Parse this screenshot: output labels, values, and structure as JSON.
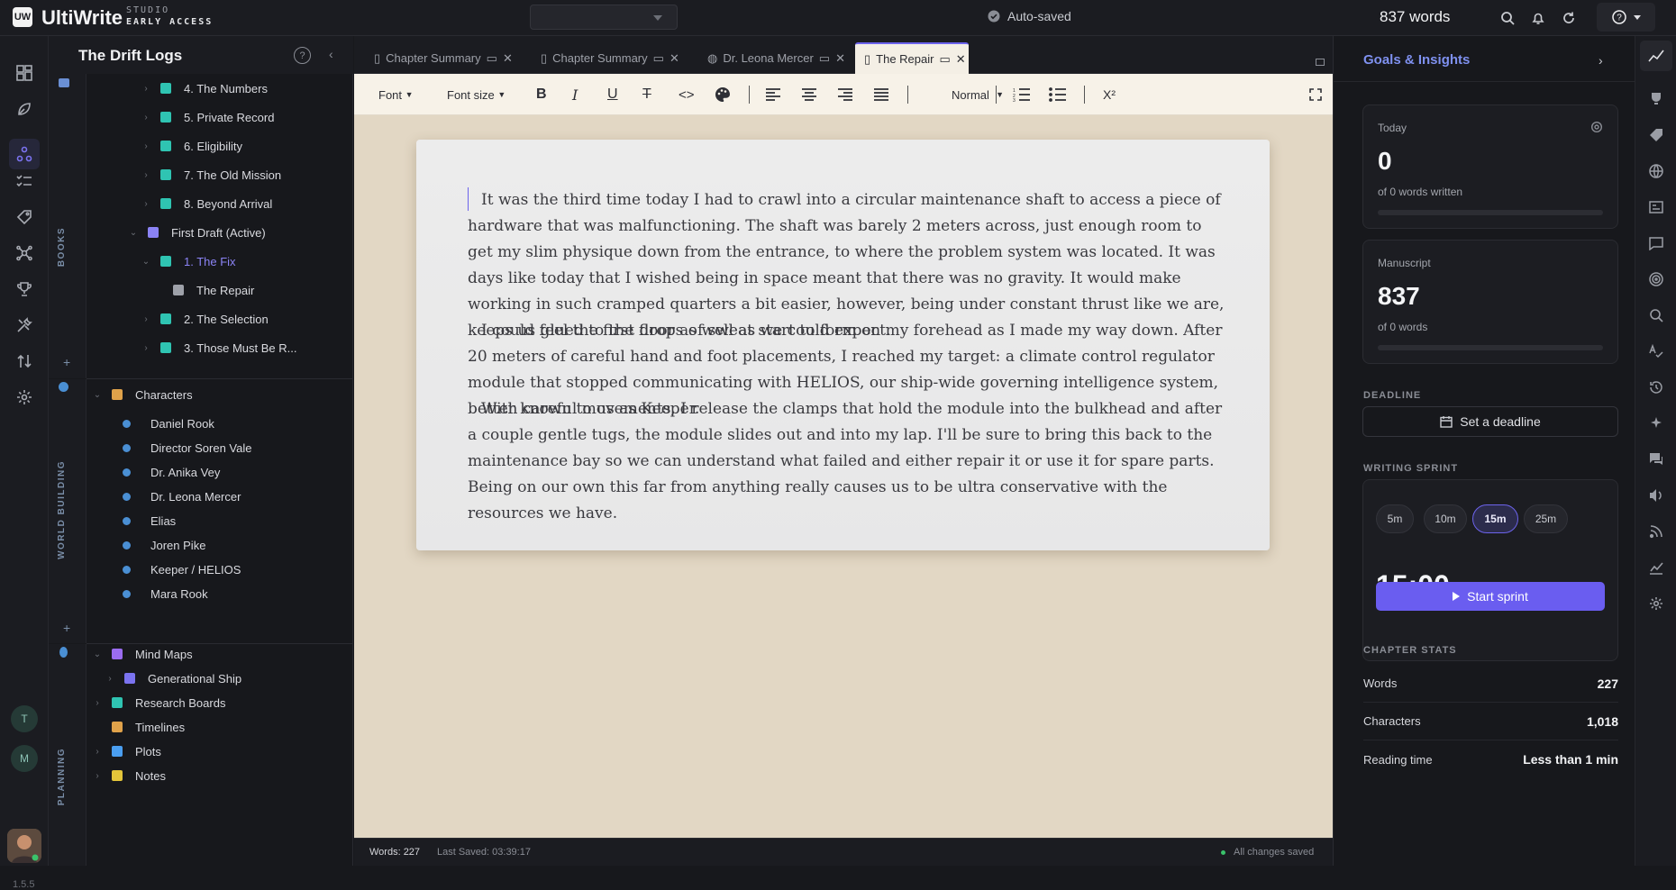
{
  "app": {
    "name": "UltiWrite",
    "sub1": "STUDIO",
    "sub2": "EARLY ACCESS",
    "logo_letters": "UW"
  },
  "topbar": {
    "autosave": "Auto-saved",
    "word_count": "837 words"
  },
  "rail": {
    "user_initials": [
      "T",
      "M"
    ],
    "version": "1.5.5"
  },
  "sidebar": {
    "project_title": "The Drift Logs",
    "books_label": "BOOKS",
    "world_label": "WORLD BUILDING",
    "planning_label": "PLANNING",
    "books": [
      {
        "label": "4. The Numbers",
        "indent": 3,
        "chev": "›",
        "icon": "#2fc4b2"
      },
      {
        "label": "5. Private Record",
        "indent": 3,
        "chev": "›",
        "icon": "#2fc4b2"
      },
      {
        "label": "6. Eligibility",
        "indent": 3,
        "chev": "›",
        "icon": "#2fc4b2"
      },
      {
        "label": "7. The Old Mission",
        "indent": 3,
        "chev": "›",
        "icon": "#2fc4b2"
      },
      {
        "label": "8. Beyond Arrival",
        "indent": 3,
        "chev": "›",
        "icon": "#2fc4b2"
      },
      {
        "label": "First Draft (Active)",
        "indent": 2,
        "chev": "⌄",
        "icon": "#8b83f5"
      },
      {
        "label": "1. The Fix",
        "indent": 3,
        "chev": "⌄",
        "icon": "#2fc4b2",
        "active": true
      },
      {
        "label": "The Repair",
        "indent": 4,
        "chev": "",
        "icon": "#9ea1a9"
      },
      {
        "label": "2. The Selection",
        "indent": 3,
        "chev": "›",
        "icon": "#2fc4b2"
      },
      {
        "label": "3. Those Must Be R...",
        "indent": 3,
        "chev": "›",
        "icon": "#2fc4b2"
      }
    ],
    "characters_header": "Characters",
    "characters": [
      "Daniel Rook",
      "Director Soren Vale",
      "Dr. Anika Vey",
      "Dr. Leona Mercer",
      "Elias",
      "Joren Pike",
      "Keeper / HELIOS",
      "Mara Rook"
    ],
    "planning": [
      {
        "label": "Mind Maps",
        "indent": 1,
        "chev": "⌄",
        "icon": "#9b6cf0"
      },
      {
        "label": "Generational Ship",
        "indent": 2,
        "chev": "›",
        "icon": "#7b73f0"
      },
      {
        "label": "Research Boards",
        "indent": 1,
        "chev": "›",
        "icon": "#2fc4b2"
      },
      {
        "label": "Timelines",
        "indent": 1,
        "chev": "",
        "icon": "#e0a24a"
      },
      {
        "label": "Plots",
        "indent": 1,
        "chev": "›",
        "icon": "#4a9ef0"
      },
      {
        "label": "Notes",
        "indent": 1,
        "chev": "›",
        "icon": "#e3c53a"
      }
    ]
  },
  "tabs": [
    {
      "label": "Chapter Summary",
      "active": false
    },
    {
      "label": "Chapter Summary",
      "active": false
    },
    {
      "label": "Dr. Leona Mercer",
      "active": false
    },
    {
      "label": "The Repair",
      "active": true
    }
  ],
  "toolbar": {
    "font": "Font",
    "font_size": "Font size",
    "style": "Normal",
    "superscript": "X²"
  },
  "editor": {
    "paragraphs": [
      "It was the third time today I had to crawl into a circular maintenance shaft to access a piece of hardware that was malfunctioning. The shaft was barely 2 meters across, just enough room to get my slim physique down from the entrance, to where the problem system was located. It was days like today that I wished being in space meant that there was no gravity. It would make working in such cramped quarters a bit easier, however, being under constant thrust like we are, keeps us glued to the floor as well as we could expect.",
      "I could feel the first drops of sweat start to form on my forehead as I made my way down. After 20 meters of careful hand and foot placements, I reached my target: a climate control regulator module that stopped communicating with HELIOS, our ship-wide governing intelligence system, better known to us as Keeper.",
      "With careful movements, I release the clamps that hold the module into the bulkhead and after a couple gentle tugs, the module slides out and into my lap. I'll be sure to bring this back to the maintenance bay so we can understand what failed and either repair it or use it for spare parts. Being on our own this far from anything really causes us to be ultra conservative with the resources we have."
    ]
  },
  "status": {
    "words": "Words: 227",
    "last_saved": "Last Saved: 03:39:17",
    "saved": "All changes saved"
  },
  "insights": {
    "title": "Goals & Insights",
    "today": {
      "label": "Today",
      "value": "0",
      "sub": "of 0 words written",
      "progress": 0
    },
    "manuscript": {
      "label": "Manuscript",
      "value": "837",
      "sub": "of 0 words",
      "progress": 0
    },
    "deadline_header": "DEADLINE",
    "deadline_button": "Set a deadline",
    "sprint_header": "WRITING SPRINT",
    "sprint_options": [
      "5m",
      "10m",
      "15m",
      "25m"
    ],
    "sprint_selected": "15m",
    "timer": "15:00",
    "start_button": "Start sprint",
    "stats_header": "CHAPTER STATS",
    "stats": [
      {
        "label": "Words",
        "value": "227"
      },
      {
        "label": "Characters",
        "value": "1,018"
      },
      {
        "label": "Reading time",
        "value": "Less than 1 min"
      }
    ]
  }
}
